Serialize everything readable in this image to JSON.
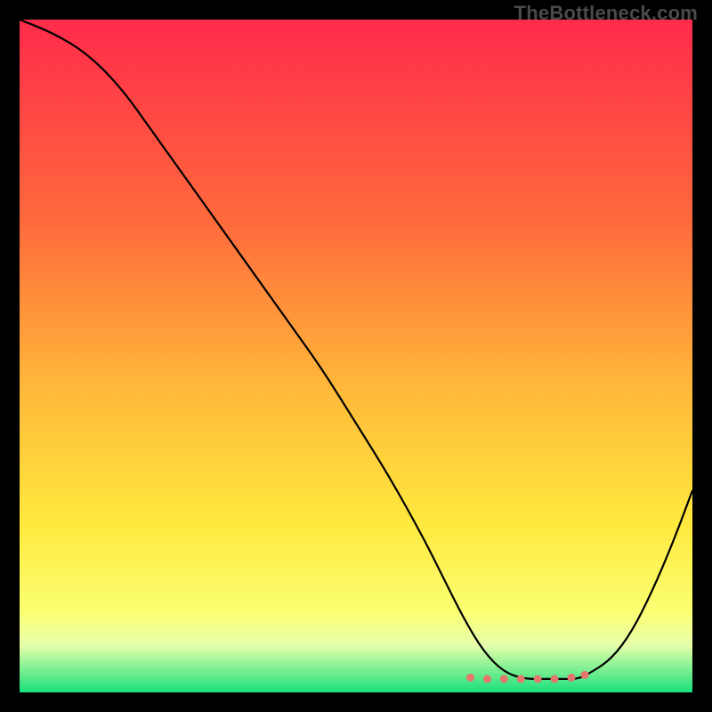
{
  "watermark": "TheBottleneck.com",
  "chart_data": {
    "type": "line",
    "title": "",
    "xlabel": "",
    "ylabel": "",
    "xlim": [
      0,
      100
    ],
    "ylim": [
      0,
      100
    ],
    "gradient_stops": [
      {
        "offset": 0,
        "color": "#ff2b4b"
      },
      {
        "offset": 30,
        "color": "#ff6a3c"
      },
      {
        "offset": 55,
        "color": "#ffb93a"
      },
      {
        "offset": 75,
        "color": "#ffe93e"
      },
      {
        "offset": 88,
        "color": "#fbff72"
      },
      {
        "offset": 93,
        "color": "#e6ffab"
      },
      {
        "offset": 100,
        "color": "#18e07a"
      }
    ],
    "series": [
      {
        "name": "bottleneck-curve",
        "color": "#000000",
        "x": [
          0,
          5,
          10,
          15,
          20,
          25,
          30,
          35,
          40,
          45,
          50,
          55,
          60,
          63,
          66,
          69,
          72,
          75,
          78,
          81,
          83,
          85,
          88,
          91,
          94,
          97,
          100
        ],
        "y": [
          100,
          98,
          95,
          90,
          83,
          76,
          69,
          62,
          55,
          48,
          40,
          32,
          23,
          17,
          11,
          6,
          3,
          2,
          2,
          2,
          2,
          3,
          5,
          9,
          15,
          22,
          30
        ]
      }
    ],
    "markers": {
      "name": "optimal-range",
      "color": "#e4766e",
      "x": [
        67,
        69.5,
        72,
        74.5,
        77,
        79.5,
        82,
        84
      ],
      "y": [
        2.2,
        2.0,
        2.0,
        2.0,
        2.0,
        2.0,
        2.2,
        2.6
      ]
    }
  }
}
